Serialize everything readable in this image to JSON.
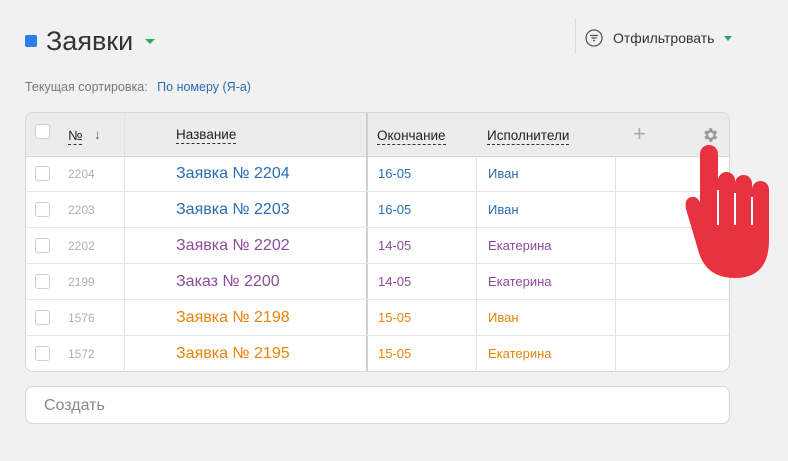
{
  "header": {
    "title": "Заявки",
    "filter_label": "Отфильтровать"
  },
  "sorting": {
    "label": "Текущая сортировка:",
    "value": "По номеру (Я-а)"
  },
  "table": {
    "columns": {
      "number": "№",
      "sort_arrow": "↓",
      "name": "Название",
      "end": "Окончание",
      "assignees": "Исполнители",
      "add": "+"
    },
    "rows": [
      {
        "num": "2204",
        "name": "Заявка № 2204",
        "end": "16-05",
        "person": "Иван",
        "color": "#2b6cb0"
      },
      {
        "num": "2203",
        "name": "Заявка № 2203",
        "end": "16-05",
        "person": "Иван",
        "color": "#2b6cb0"
      },
      {
        "num": "2202",
        "name": "Заявка № 2202",
        "end": "14-05",
        "person": "Екатерина",
        "color": "#8e4a9e"
      },
      {
        "num": "2199",
        "name": "Заказ № 2200",
        "end": "14-05",
        "person": "Екатерина",
        "color": "#8e4a9e"
      },
      {
        "num": "1576",
        "name": "Заявка № 2198",
        "end": "15-05",
        "person": "Иван",
        "color": "#e8830c"
      },
      {
        "num": "1572",
        "name": "Заявка № 2195",
        "end": "15-05",
        "person": "Екатерина",
        "color": "#e8830c"
      }
    ]
  },
  "create": {
    "placeholder": "Создать"
  },
  "icons": {
    "title_square": "blue-square-icon",
    "filter": "filter-icon",
    "settings": "gear-icon",
    "pointer": "hand-pointer-icon"
  },
  "colors": {
    "accent_blue": "#2b7de9",
    "caret_green": "#27ae60",
    "hand_red": "#e8323f"
  }
}
